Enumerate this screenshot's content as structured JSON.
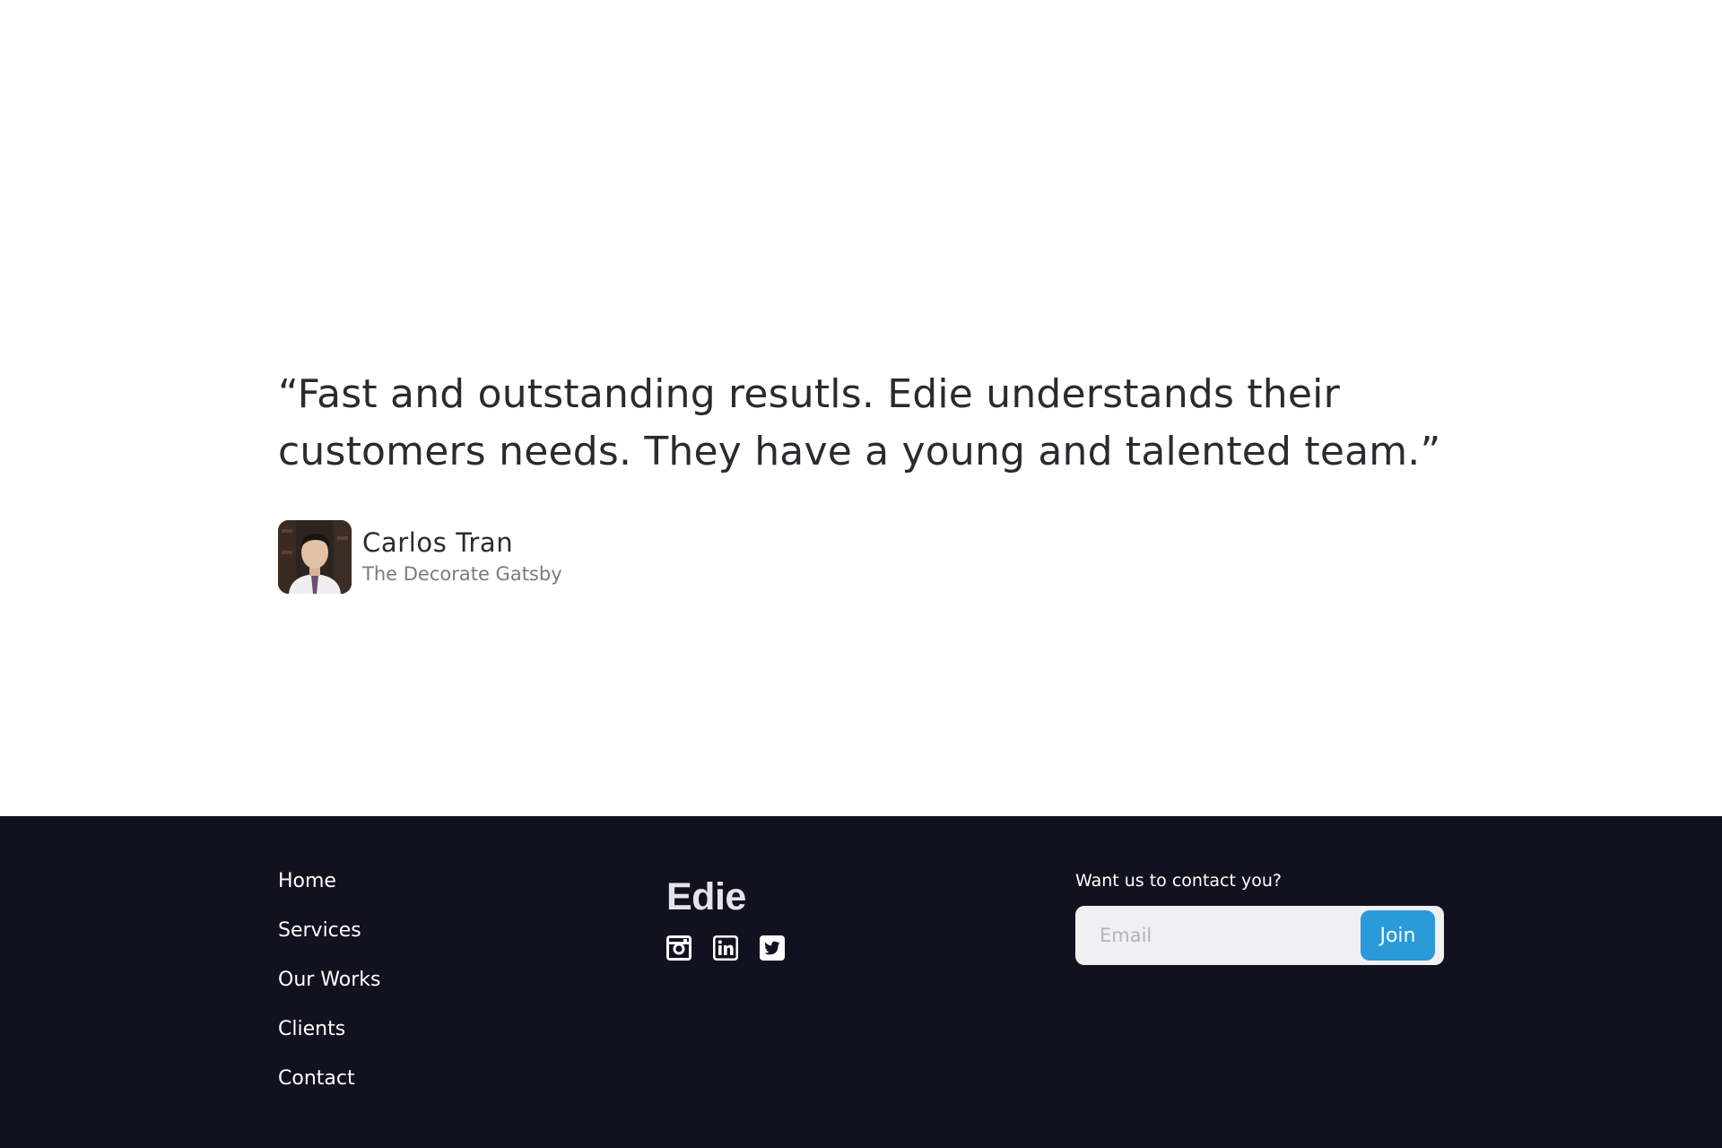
{
  "testimonial": {
    "quote_line1": "“Fast and outstanding resutls. Edie understands their",
    "quote_line2": "customers needs. They have a young and talented team.”",
    "author_name": "Carlos Tran",
    "author_company": "The Decorate Gatsby"
  },
  "footer": {
    "nav": [
      "Home",
      "Services",
      "Our Works",
      "Clients",
      "Contact"
    ],
    "brand": "Edie",
    "socials": [
      "instagram-icon",
      "linkedin-icon",
      "twitter-icon"
    ],
    "contact_label": "Want us to contact you?",
    "email_placeholder": "Email",
    "join_label": "Join"
  },
  "colors": {
    "footer_bg": "#12111f",
    "accent": "#2a9ad8",
    "text_dark": "#2b2b2f",
    "text_muted": "#7b7b7f"
  }
}
